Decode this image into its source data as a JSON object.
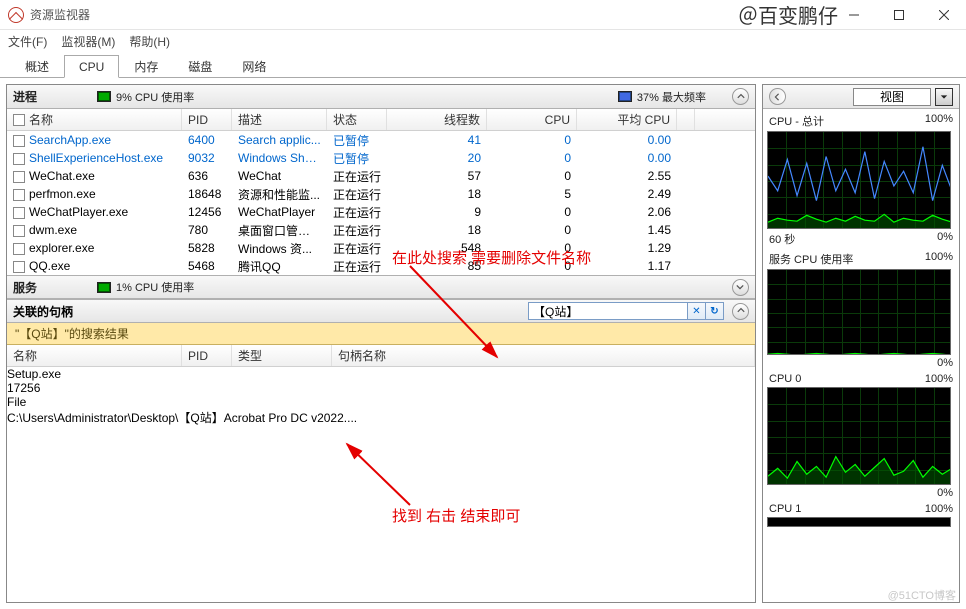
{
  "window": {
    "title": "资源监视器",
    "watermark": "＠百变鹏仔",
    "bottomWatermark": "@51CTO博客"
  },
  "menu": {
    "file": "文件(F)",
    "monitor": "监视器(M)",
    "help": "帮助(H)"
  },
  "tabs": {
    "overview": "概述",
    "cpu": "CPU",
    "memory": "内存",
    "disk": "磁盘",
    "network": "网络"
  },
  "processes": {
    "title": "进程",
    "cpuUsage": "9% CPU 使用率",
    "maxFreq": "37% 最大频率",
    "cols": {
      "name": "名称",
      "pid": "PID",
      "desc": "描述",
      "stat": "状态",
      "threads": "线程数",
      "cpu": "CPU",
      "avg": "平均 CPU"
    },
    "rows": [
      {
        "name": "SearchApp.exe",
        "pid": "6400",
        "desc": "Search applic...",
        "stat": "已暂停",
        "thr": "41",
        "cpu": "0",
        "avg": "0.00",
        "linked": true
      },
      {
        "name": "ShellExperienceHost.exe",
        "pid": "9032",
        "desc": "Windows She...",
        "stat": "已暂停",
        "thr": "20",
        "cpu": "0",
        "avg": "0.00",
        "linked": true
      },
      {
        "name": "WeChat.exe",
        "pid": "636",
        "desc": "WeChat",
        "stat": "正在运行",
        "thr": "57",
        "cpu": "0",
        "avg": "2.55"
      },
      {
        "name": "perfmon.exe",
        "pid": "18648",
        "desc": "资源和性能监...",
        "stat": "正在运行",
        "thr": "18",
        "cpu": "5",
        "avg": "2.49"
      },
      {
        "name": "WeChatPlayer.exe",
        "pid": "12456",
        "desc": "WeChatPlayer",
        "stat": "正在运行",
        "thr": "9",
        "cpu": "0",
        "avg": "2.06"
      },
      {
        "name": "dwm.exe",
        "pid": "780",
        "desc": "桌面窗口管理器",
        "stat": "正在运行",
        "thr": "18",
        "cpu": "0",
        "avg": "1.45"
      },
      {
        "name": "explorer.exe",
        "pid": "5828",
        "desc": "Windows 资...",
        "stat": "正在运行",
        "thr": "548",
        "cpu": "0",
        "avg": "1.29"
      },
      {
        "name": "QQ.exe",
        "pid": "5468",
        "desc": "腾讯QQ",
        "stat": "正在运行",
        "thr": "85",
        "cpu": "0",
        "avg": "1.17"
      }
    ]
  },
  "services": {
    "title": "服务",
    "cpuUsage": "1% CPU 使用率"
  },
  "handles": {
    "title": "关联的句柄",
    "searchValue": "【Q站】",
    "resultsLabel": "\"【Q站】\"的搜索结果",
    "cols": {
      "name": "名称",
      "pid": "PID",
      "type": "类型",
      "handle": "句柄名称"
    },
    "rows": [
      {
        "name": "Setup.exe",
        "pid": "17256",
        "type": "File",
        "handle": "C:\\Users\\Administrator\\Desktop\\【Q站】Acrobat Pro DC v2022...."
      }
    ]
  },
  "rightPanel": {
    "viewLabel": "视图",
    "graphs": {
      "total": {
        "title": "CPU - 总计",
        "pct": "100%",
        "btmL": "60 秒",
        "btmR": "0%"
      },
      "svc": {
        "title": "服务 CPU 使用率",
        "pct": "100%",
        "btmR": "0%"
      },
      "cpu0": {
        "title": "CPU 0",
        "pct": "100%",
        "btmR": "0%"
      },
      "cpu1": {
        "title": "CPU 1",
        "pct": "100%"
      }
    }
  },
  "annotations": {
    "top": "在此处搜索 需要删除文件名称",
    "bottom": "找到 右击 结束即可"
  }
}
